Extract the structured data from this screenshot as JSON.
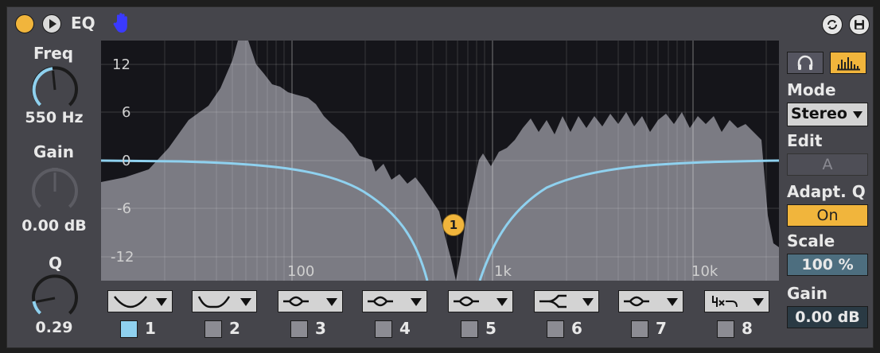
{
  "device": {
    "title": "EQ"
  },
  "left": {
    "freq": {
      "label": "Freq",
      "value": "550 Hz"
    },
    "gain": {
      "label": "Gain",
      "value": "0.00 dB"
    },
    "q": {
      "label": "Q",
      "value": "0.29"
    }
  },
  "graph": {
    "y_ticks": [
      "12",
      "6",
      "0",
      "-6",
      "-12"
    ],
    "x_ticks": [
      "100",
      "1k",
      "10k"
    ],
    "band_marker": "1"
  },
  "bands": [
    {
      "num": "1",
      "filter": "low-cut-icon",
      "active": true
    },
    {
      "num": "2",
      "filter": "low-shelf-icon",
      "active": false
    },
    {
      "num": "3",
      "filter": "bell-icon",
      "active": false
    },
    {
      "num": "4",
      "filter": "bell-icon",
      "active": false
    },
    {
      "num": "5",
      "filter": "bell-icon",
      "active": false
    },
    {
      "num": "6",
      "filter": "high-shelf-icon",
      "active": false
    },
    {
      "num": "7",
      "filter": "bell-icon",
      "active": false
    },
    {
      "num": "8",
      "filter": "4x-filter-icon",
      "active": false
    }
  ],
  "right": {
    "mode_label": "Mode",
    "mode_value": "Stereo",
    "edit_label": "Edit",
    "edit_value": "A",
    "adaptq_label": "Adapt. Q",
    "adaptq_value": "On",
    "scale_label": "Scale",
    "scale_value": "100 %",
    "gain_label": "Gain",
    "gain_value": "0.00 dB"
  },
  "colors": {
    "accent": "#f1b53c",
    "curve": "#8fd1ef",
    "panel": "#45454b",
    "graph_bg": "#15151a"
  }
}
